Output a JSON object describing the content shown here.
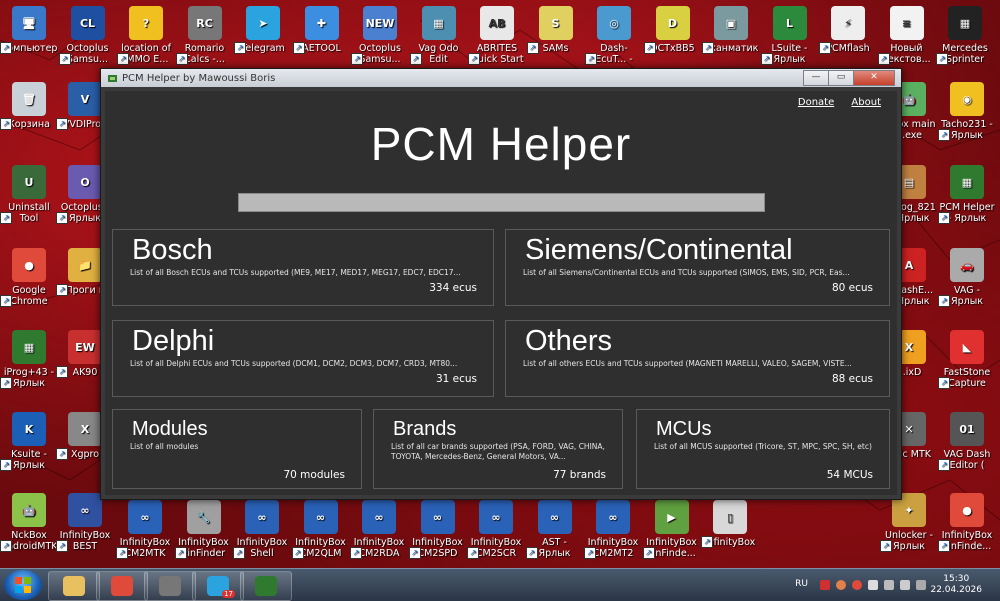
{
  "desktop": {
    "icons": [
      {
        "label": "Компьютер",
        "color": "#3a78c9",
        "glyph": "🖥"
      },
      {
        "label": "Octoplus Samsu...",
        "color": "#1f4fa0",
        "glyph": "CL"
      },
      {
        "label": "location of IMMO E...",
        "color": "#f0c020",
        "glyph": "?"
      },
      {
        "label": "Romario Calcs -...",
        "color": "#777777",
        "glyph": "RC"
      },
      {
        "label": "Telegram",
        "color": "#2aa3df",
        "glyph": "➤"
      },
      {
        "label": "AETOOL",
        "color": "#3c8ee0",
        "glyph": "✚"
      },
      {
        "label": "Octoplus Samsu...",
        "color": "#4b7fd0",
        "glyph": "NEW"
      },
      {
        "label": "Vag Odo Edit",
        "color": "#4d8fb0",
        "glyph": "▦"
      },
      {
        "label": "ABRITES Quick Start",
        "color": "#e8e8e8",
        "glyph": "AB"
      },
      {
        "label": "SAMs",
        "color": "#e0d060",
        "glyph": "S"
      },
      {
        "label": "Dash-EcuT... - Ярлык",
        "color": "#4a9ad0",
        "glyph": "◎"
      },
      {
        "label": "DCTxBB5",
        "color": "#d8d040",
        "glyph": "D"
      },
      {
        "label": "Сканматик",
        "color": "#7a9aa0",
        "glyph": "▣"
      },
      {
        "label": "LSuite - Ярлык",
        "color": "#2c8a3c",
        "glyph": "L"
      },
      {
        "label": "PCMflash",
        "color": "#eeeeee",
        "glyph": "⚡"
      },
      {
        "label": "Новый текстов...",
        "color": "#f2f2f2",
        "glyph": "≡"
      },
      {
        "label": "Mercedes Sprinter Vi...",
        "color": "#222222",
        "glyph": "▦"
      }
    ],
    "left_icons": [
      {
        "label": "Корзина",
        "color": "#c8d0d8",
        "glyph": "🗑"
      },
      {
        "label": "Uninstall Tool",
        "color": "#3a6a3a",
        "glyph": "U"
      },
      {
        "label": "Google Chrome",
        "color": "#e04a3a",
        "glyph": "●"
      },
      {
        "label": "iProg+43 - Ярлык",
        "color": "#2f7a2f",
        "glyph": "▦"
      },
      {
        "label": "Ksuite - Ярлык",
        "color": "#1b5fb6",
        "glyph": "K"
      },
      {
        "label": "NckBox AndroidMTK",
        "color": "#8bc34a",
        "glyph": "🤖"
      }
    ],
    "col2_icons": [
      {
        "label": "VVDIProg",
        "color": "#2a5fa8",
        "glyph": "V"
      },
      {
        "label": "Octoplus - Ярлык",
        "color": "#6a5ab0",
        "glyph": "O"
      },
      {
        "label": "Проги к",
        "color": "#e0b040",
        "glyph": "📁"
      },
      {
        "label": "AK90",
        "color": "#c83030",
        "glyph": "EW"
      },
      {
        "label": "Xgpro",
        "color": "#888888",
        "glyph": "X"
      },
      {
        "label": "InfinityBox BEST",
        "color": "#3050a0",
        "glyph": "∞"
      }
    ],
    "right_icons": [
      {
        "label": "...box main ...exe",
        "color": "#5ab060",
        "glyph": "🤖"
      },
      {
        "label": "Tacho231 - Ярлык",
        "color": "#f0c020",
        "glyph": "◉"
      },
      {
        "label": "...prog_821 ...Ярлык",
        "color": "#c08040",
        "glyph": "▤"
      },
      {
        "label": "PCM Helper - Ярлык",
        "color": "#2f7a2f",
        "glyph": "▦"
      },
      {
        "label": "...DashE... ...Ярлык",
        "color": "#cc2222",
        "glyph": "A"
      },
      {
        "label": "VAG - Ярлык",
        "color": "#aaaaaa",
        "glyph": "🚗"
      },
      {
        "label": "...ixD",
        "color": "#f0a020",
        "glyph": "X"
      },
      {
        "label": "FastStone Capture",
        "color": "#e03030",
        "glyph": "◣"
      },
      {
        "label": "...ric MTK",
        "color": "#666666",
        "glyph": "✕"
      },
      {
        "label": "VAG Dash Editor ( 24c...",
        "color": "#555555",
        "glyph": "01"
      },
      {
        "label": "Unlocker - Ярлык",
        "color": "#caa040",
        "glyph": "✦"
      },
      {
        "label": "InfinityBox PinFinde...",
        "color": "#e04a3a",
        "glyph": "●"
      }
    ],
    "bottom_icons": [
      {
        "label": "InfinityBox CM2MTK",
        "color": "#2a62b8",
        "glyph": "∞"
      },
      {
        "label": "InfinityBox PinFinder",
        "color": "#a0a0a0",
        "glyph": "🔧"
      },
      {
        "label": "InfinityBox Shell",
        "color": "#2a62b8",
        "glyph": "∞"
      },
      {
        "label": "InfinityBox CM2QLM",
        "color": "#2a62b8",
        "glyph": "∞"
      },
      {
        "label": "InfinityBox CM2RDA",
        "color": "#2a62b8",
        "glyph": "∞"
      },
      {
        "label": "InfinityBox CM2SPD",
        "color": "#2a62b8",
        "glyph": "∞"
      },
      {
        "label": "InfinityBox CM2SCR",
        "color": "#2a62b8",
        "glyph": "∞"
      },
      {
        "label": "AST - Ярлык",
        "color": "#2a62b8",
        "glyph": "∞"
      },
      {
        "label": "InfinityBox CM2MT2",
        "color": "#2a62b8",
        "glyph": "∞"
      },
      {
        "label": "InfinityBox PinFinde...",
        "color": "#60a040",
        "glyph": "▶"
      },
      {
        "label": "InfinityBox",
        "color": "#d8d8d8",
        "glyph": "▯"
      }
    ]
  },
  "window": {
    "title": "PCM Helper by Mawoussi Boris",
    "controls": {
      "minimize": "—",
      "maximize": "▭",
      "close": "✕"
    },
    "links": {
      "donate": "Donate",
      "about": "About"
    },
    "app_title": "PCM Helper",
    "progress": 0,
    "cards": {
      "bosch": {
        "title": "Bosch",
        "desc": "List of all Bosch ECUs and TCUs supported (ME9, ME17, MED17, MEG17, EDC7, EDC17...",
        "count": "334 ecus"
      },
      "siemens": {
        "title": "Siemens/Continental",
        "desc": "List of all Siemens/Continental ECUs and TCUs supported (SIMOS, EMS, SID, PCR, Eas...",
        "count": "80 ecus"
      },
      "delphi": {
        "title": "Delphi",
        "desc": "List of all Delphi ECUs and TCUs supported (DCM1, DCM2, DCM3, DCM7, CRD3, MT80...",
        "count": "31 ecus"
      },
      "others": {
        "title": "Others",
        "desc": "List of all others ECUs and TCUs supported (MAGNETI MARELLI, VALEO, SAGEM, VISTE...",
        "count": "88 ecus"
      },
      "modules": {
        "title": "Modules",
        "desc": "List of all modules",
        "count": "70 modules"
      },
      "brands": {
        "title": "Brands",
        "desc": "List of all car brands supported (PSA, FORD, VAG, CHINA, TOYOTA, Mercedes-Benz, General Motors, VA...",
        "count": "77 brands"
      },
      "mcus": {
        "title": "MCUs",
        "desc": "List of all MCUS supported (Tricore, ST, MPC, SPC, SH, etc)",
        "count": "54 MCUs"
      }
    }
  },
  "taskbar": {
    "apps": [
      {
        "name": "explorer",
        "color": "#e8c060"
      },
      {
        "name": "chrome",
        "color": "#e04a3a"
      },
      {
        "name": "romario-calcs",
        "color": "#777777"
      },
      {
        "name": "telegram",
        "color": "#2aa3df",
        "badge": "17"
      },
      {
        "name": "pcm-helper",
        "color": "#2f7a2f"
      }
    ],
    "language": "RU",
    "time": "15:30",
    "date": "22.04.2026"
  }
}
